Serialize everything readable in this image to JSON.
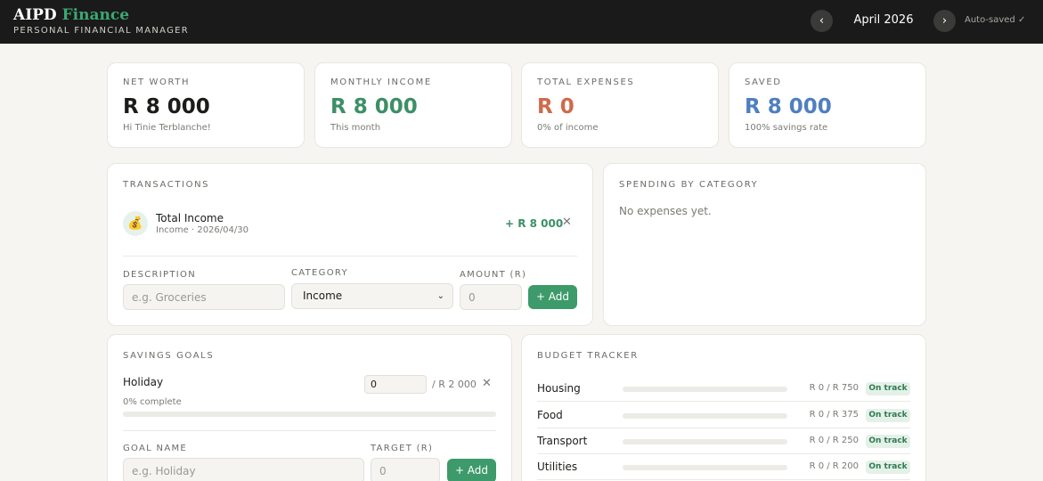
{
  "header": {
    "brand_main": "AIPD",
    "brand_accent": "Finance",
    "tagline": "PERSONAL FINANCIAL MANAGER",
    "prev_icon": "chevron-left-icon",
    "prev_glyph": "‹",
    "month": "April 2026",
    "next_icon": "chevron-right-icon",
    "next_glyph": "›",
    "autosave": "Auto-saved ✓"
  },
  "stats": [
    {
      "label": "NET WORTH",
      "value": "R 8 000",
      "sub": "Hi Tinie Terblanche!",
      "color": "#1c1c1a"
    },
    {
      "label": "MONTHLY INCOME",
      "value": "R 8 000",
      "sub": "This month",
      "color": "#3d8f66"
    },
    {
      "label": "TOTAL EXPENSES",
      "value": "R 0",
      "sub": "0% of income",
      "color": "#cf6a4c"
    },
    {
      "label": "SAVED",
      "value": "R 8 000",
      "sub": "100% savings rate",
      "color": "#4f7fc0"
    }
  ],
  "transactions": {
    "title": "TRANSACTIONS",
    "items": [
      {
        "icon": "money-bag-icon",
        "glyph": "💰",
        "name": "Total Income",
        "meta": "Income · 2026/04/30",
        "amount": "+ R 8 000",
        "delete_glyph": "✕"
      }
    ],
    "form": {
      "description_label": "DESCRIPTION",
      "description_placeholder": "e.g. Groceries",
      "category_label": "CATEGORY",
      "category_value": "Income",
      "category_chevron": "⌄",
      "amount_label": "AMOUNT (R)",
      "amount_placeholder": "0",
      "add_label": "+ Add"
    }
  },
  "spending": {
    "title": "SPENDING BY CATEGORY",
    "empty": "No expenses yet."
  },
  "savings": {
    "title": "SAVINGS GOALS",
    "goals": [
      {
        "name": "Holiday",
        "current": "0",
        "target": "/ R 2 000",
        "progress_text": "0% complete",
        "progress": 0,
        "delete_glyph": "✕"
      }
    ],
    "form": {
      "name_label": "GOAL NAME",
      "name_placeholder": "e.g. Holiday",
      "target_label": "TARGET (R)",
      "target_placeholder": "0",
      "add_label": "+ Add"
    }
  },
  "budget": {
    "title": "BUDGET TRACKER",
    "rows": [
      {
        "name": "Housing",
        "value": "R 0 / R 750",
        "status": "On track",
        "progress": 0
      },
      {
        "name": "Food",
        "value": "R 0 / R 375",
        "status": "On track",
        "progress": 0
      },
      {
        "name": "Transport",
        "value": "R 0 / R 250",
        "status": "On track",
        "progress": 0
      },
      {
        "name": "Utilities",
        "value": "R 0 / R 200",
        "status": "On track",
        "progress": 0
      }
    ]
  }
}
